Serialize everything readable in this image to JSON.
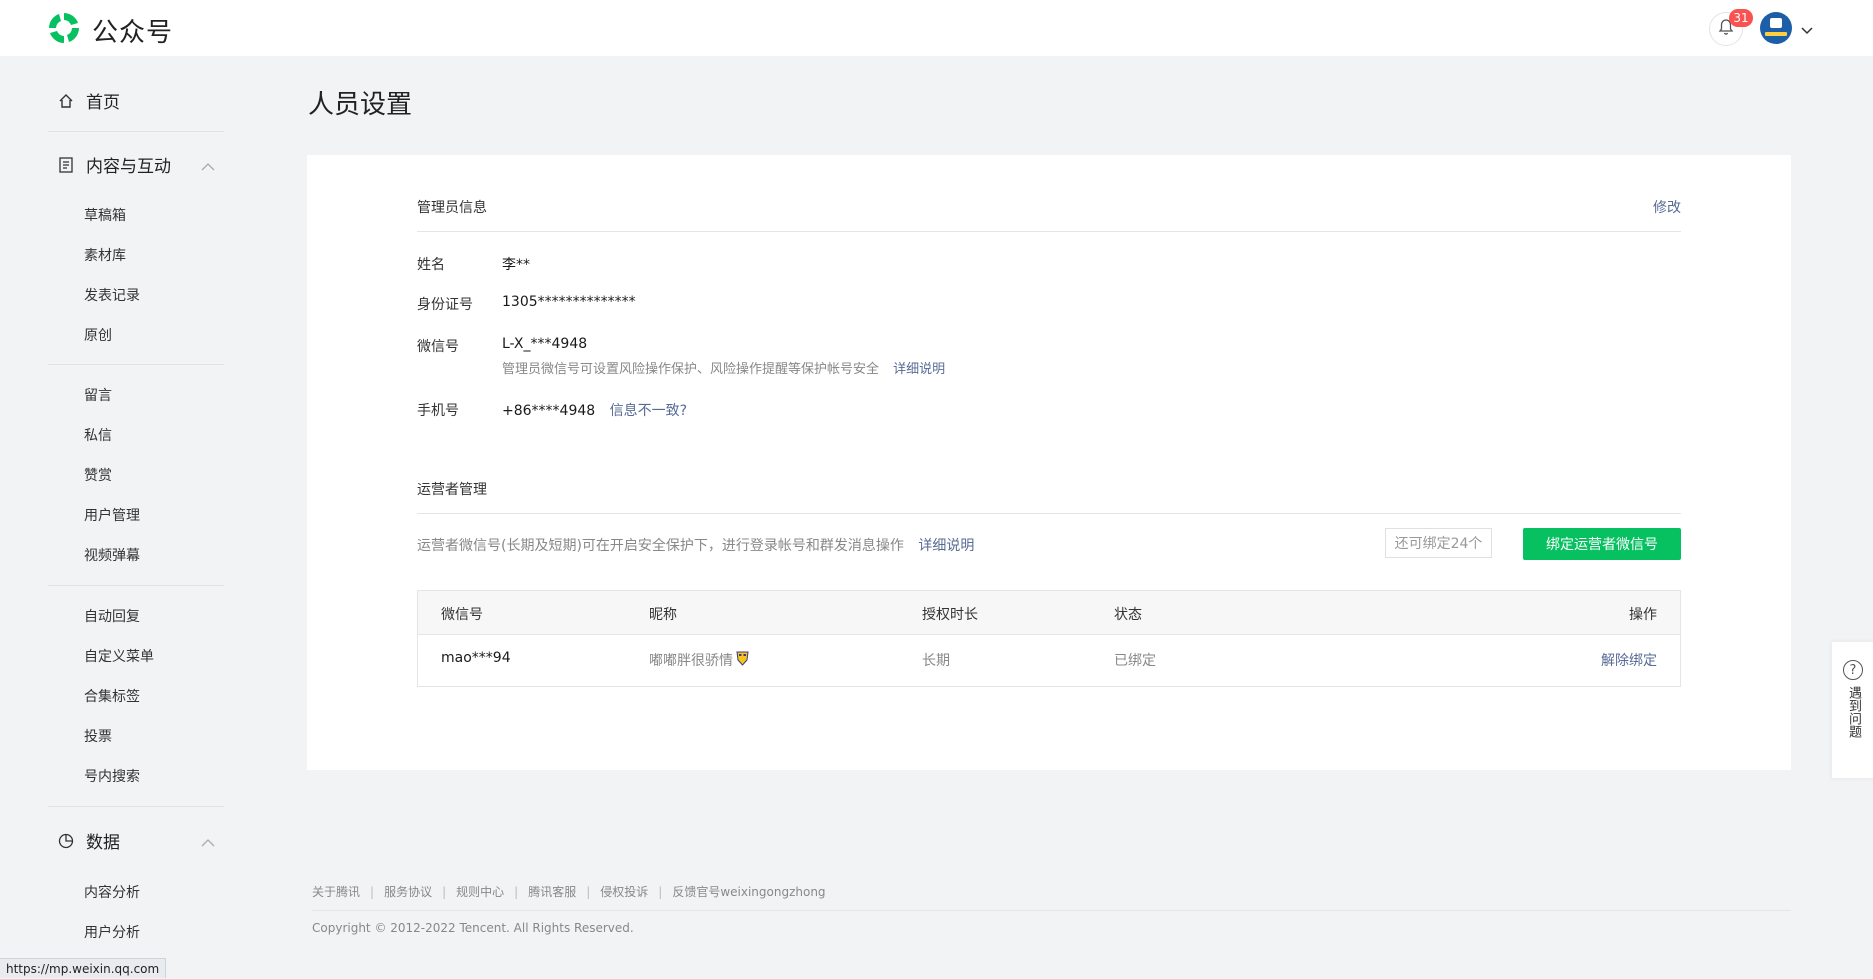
{
  "app": {
    "name": "公众号"
  },
  "header": {
    "notification_count": "31"
  },
  "sidebar": {
    "home": "首页",
    "content_group": "内容与互动",
    "content_items": [
      "草稿箱",
      "素材库",
      "发表记录",
      "原创"
    ],
    "interaction_items": [
      "留言",
      "私信",
      "赞赏",
      "用户管理",
      "视频弹幕"
    ],
    "feature_items": [
      "自动回复",
      "自定义菜单",
      "合集标签",
      "投票",
      "号内搜索"
    ],
    "data_group": "数据",
    "data_items": [
      "内容分析",
      "用户分析"
    ]
  },
  "page": {
    "title": "人员设置"
  },
  "admin": {
    "section_title": "管理员信息",
    "edit_label": "修改",
    "name_label": "姓名",
    "name_value": "李**",
    "id_label": "身份证号",
    "id_value": "1305**************",
    "wechat_label": "微信号",
    "wechat_value": "L-X_***4948",
    "wechat_hint": "管理员微信号可设置风险操作保护、风险操作提醒等保护帐号安全",
    "wechat_hint_link": "详细说明",
    "phone_label": "手机号",
    "phone_value": "+86****4948",
    "phone_link": "信息不一致?"
  },
  "operators": {
    "section_title": "运营者管理",
    "desc": "运营者微信号(长期及短期)可在开启安全保护下，进行登录帐号和群发消息操作",
    "desc_link": "详细说明",
    "remaining": "还可绑定24个",
    "bind_button": "绑定运营者微信号",
    "columns": [
      "微信号",
      "昵称",
      "授权时长",
      "状态",
      "操作"
    ],
    "rows": [
      {
        "wechat": "mao***94",
        "nickname": "嘟嘟胖很骄情",
        "duration": "长期",
        "status": "已绑定",
        "action": "解除绑定"
      }
    ]
  },
  "help": {
    "label": "遇到问题"
  },
  "footer": {
    "links": [
      "关于腾讯",
      "服务协议",
      "规则中心",
      "腾讯客服",
      "侵权投诉",
      "反馈官号weixingongzhong"
    ],
    "copyright": "Copyright © 2012-2022 Tencent. All Rights Reserved."
  },
  "statusbar": {
    "url": "https://mp.weixin.qq.com"
  }
}
